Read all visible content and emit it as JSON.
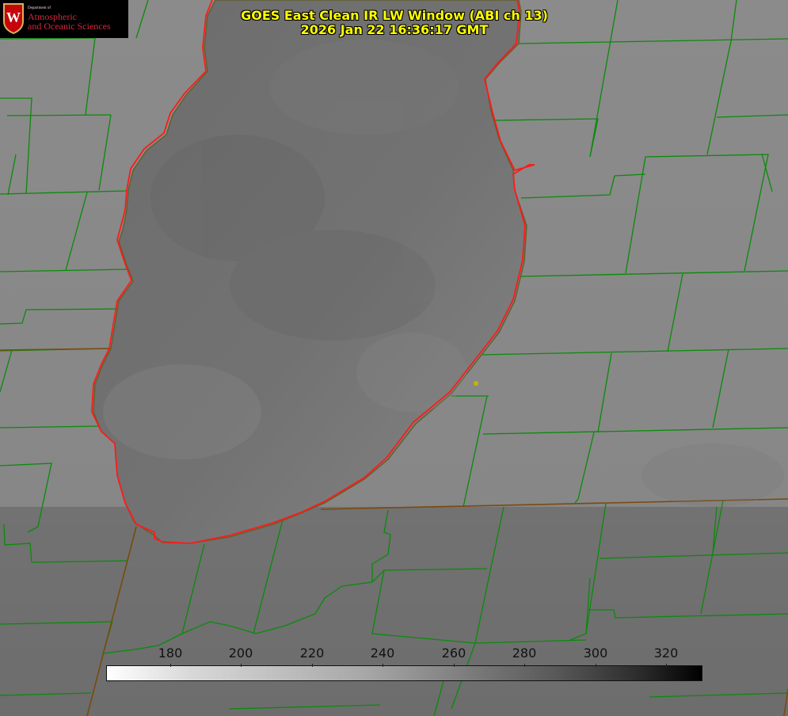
{
  "header": {
    "title_line1": "GOES East Clean IR LW Window (ABI ch 13)",
    "title_line2": "2026 Jan 22 16:36:17 GMT"
  },
  "logo": {
    "department": "Department of",
    "line1": "Atmospheric",
    "line2": "and Oceanic Sciences",
    "crest_letter": "W"
  },
  "colorbar": {
    "labels": [
      "180",
      "200",
      "220",
      "240",
      "260",
      "280",
      "300",
      "320"
    ]
  },
  "colors": {
    "boundary": "#008000",
    "lake_outline": "#ff0000",
    "title": "#ffff00"
  }
}
